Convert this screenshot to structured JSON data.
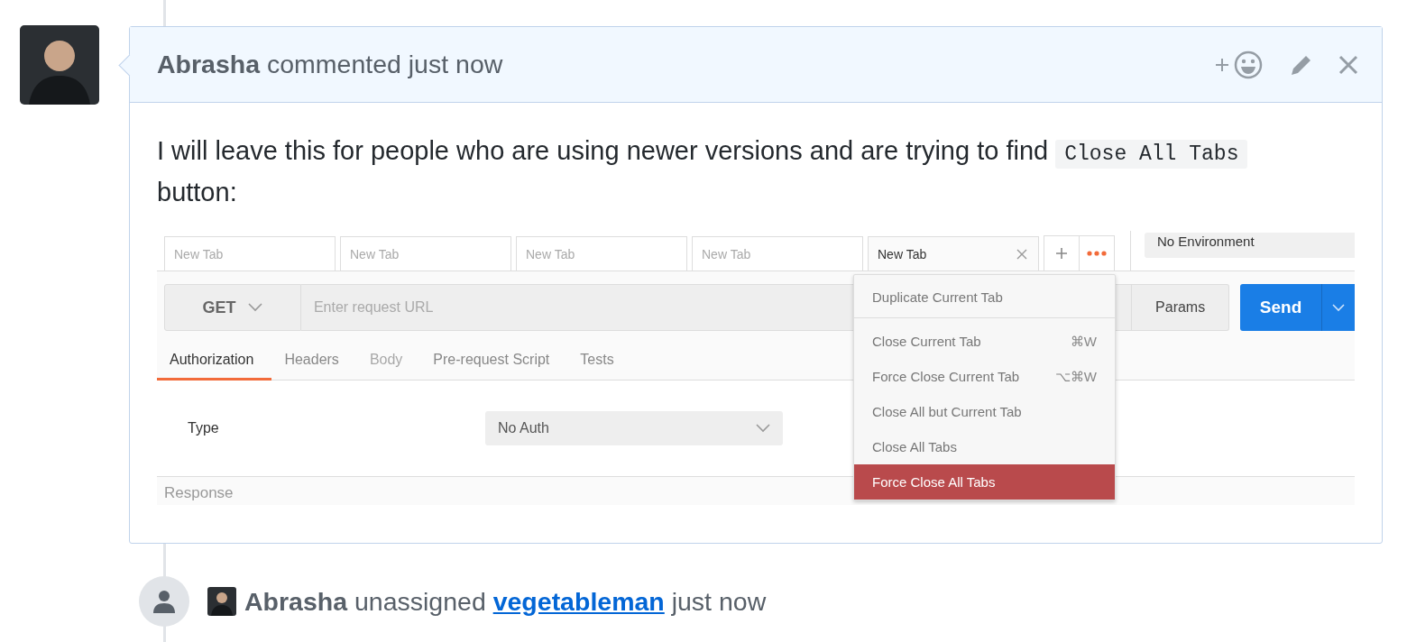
{
  "comment": {
    "author": "Abrasha",
    "action": "commented just now",
    "body_text": "I will leave this for people who are using newer versions and are trying to find",
    "body_code": "Close All Tabs",
    "body_tail": "button:"
  },
  "app": {
    "tabs": [
      {
        "label": "New Tab",
        "selected": false
      },
      {
        "label": "New Tab",
        "selected": false
      },
      {
        "label": "New Tab",
        "selected": false
      },
      {
        "label": "New Tab",
        "selected": false
      },
      {
        "label": "New Tab",
        "selected": true
      }
    ],
    "environment": "No Environment",
    "method": "GET",
    "url_placeholder": "Enter request URL",
    "params": "Params",
    "send": "Send",
    "subtabs": [
      {
        "label": "Authorization",
        "selected": true,
        "disabled": false
      },
      {
        "label": "Headers",
        "selected": false,
        "disabled": false
      },
      {
        "label": "Body",
        "selected": false,
        "disabled": true
      },
      {
        "label": "Pre-request Script",
        "selected": false,
        "disabled": false
      },
      {
        "label": "Tests",
        "selected": false,
        "disabled": false
      }
    ],
    "type_label": "Type",
    "auth_value": "No Auth",
    "response_label": "Response",
    "menu": [
      {
        "label": "Duplicate Current Tab",
        "selected": false,
        "separator_after": true
      },
      {
        "label": "Close Current Tab",
        "shortcut": "⌘W",
        "selected": false,
        "separator_after": false
      },
      {
        "label": "Force Close Current Tab",
        "shortcut": "⌥⌘W",
        "selected": false,
        "separator_after": false
      },
      {
        "label": "Close All but Current Tab",
        "selected": false,
        "separator_after": false
      },
      {
        "label": "Close All Tabs",
        "selected": false,
        "separator_after": false
      },
      {
        "label": "Force Close All Tabs",
        "selected": true,
        "separator_after": false
      }
    ]
  },
  "event": {
    "author": "Abrasha",
    "action": "unassigned",
    "user": "vegetableman",
    "time": "just now"
  }
}
